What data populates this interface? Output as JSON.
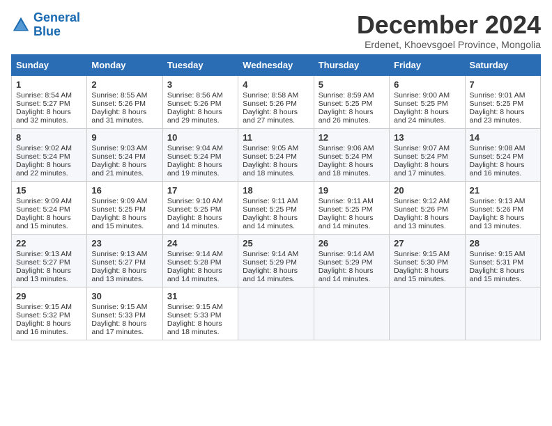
{
  "logo": {
    "line1": "General",
    "line2": "Blue"
  },
  "title": "December 2024",
  "location": "Erdenet, Khoevsgoel Province, Mongolia",
  "days_header": [
    "Sunday",
    "Monday",
    "Tuesday",
    "Wednesday",
    "Thursday",
    "Friday",
    "Saturday"
  ],
  "weeks": [
    [
      {
        "day": "1",
        "sunrise": "8:54 AM",
        "sunset": "5:27 PM",
        "daylight": "8 hours and 32 minutes."
      },
      {
        "day": "2",
        "sunrise": "8:55 AM",
        "sunset": "5:26 PM",
        "daylight": "8 hours and 31 minutes."
      },
      {
        "day": "3",
        "sunrise": "8:56 AM",
        "sunset": "5:26 PM",
        "daylight": "8 hours and 29 minutes."
      },
      {
        "day": "4",
        "sunrise": "8:58 AM",
        "sunset": "5:26 PM",
        "daylight": "8 hours and 27 minutes."
      },
      {
        "day": "5",
        "sunrise": "8:59 AM",
        "sunset": "5:25 PM",
        "daylight": "8 hours and 26 minutes."
      },
      {
        "day": "6",
        "sunrise": "9:00 AM",
        "sunset": "5:25 PM",
        "daylight": "8 hours and 24 minutes."
      },
      {
        "day": "7",
        "sunrise": "9:01 AM",
        "sunset": "5:25 PM",
        "daylight": "8 hours and 23 minutes."
      }
    ],
    [
      {
        "day": "8",
        "sunrise": "9:02 AM",
        "sunset": "5:24 PM",
        "daylight": "8 hours and 22 minutes."
      },
      {
        "day": "9",
        "sunrise": "9:03 AM",
        "sunset": "5:24 PM",
        "daylight": "8 hours and 21 minutes."
      },
      {
        "day": "10",
        "sunrise": "9:04 AM",
        "sunset": "5:24 PM",
        "daylight": "8 hours and 19 minutes."
      },
      {
        "day": "11",
        "sunrise": "9:05 AM",
        "sunset": "5:24 PM",
        "daylight": "8 hours and 18 minutes."
      },
      {
        "day": "12",
        "sunrise": "9:06 AM",
        "sunset": "5:24 PM",
        "daylight": "8 hours and 18 minutes."
      },
      {
        "day": "13",
        "sunrise": "9:07 AM",
        "sunset": "5:24 PM",
        "daylight": "8 hours and 17 minutes."
      },
      {
        "day": "14",
        "sunrise": "9:08 AM",
        "sunset": "5:24 PM",
        "daylight": "8 hours and 16 minutes."
      }
    ],
    [
      {
        "day": "15",
        "sunrise": "9:09 AM",
        "sunset": "5:24 PM",
        "daylight": "8 hours and 15 minutes."
      },
      {
        "day": "16",
        "sunrise": "9:09 AM",
        "sunset": "5:25 PM",
        "daylight": "8 hours and 15 minutes."
      },
      {
        "day": "17",
        "sunrise": "9:10 AM",
        "sunset": "5:25 PM",
        "daylight": "8 hours and 14 minutes."
      },
      {
        "day": "18",
        "sunrise": "9:11 AM",
        "sunset": "5:25 PM",
        "daylight": "8 hours and 14 minutes."
      },
      {
        "day": "19",
        "sunrise": "9:11 AM",
        "sunset": "5:25 PM",
        "daylight": "8 hours and 14 minutes."
      },
      {
        "day": "20",
        "sunrise": "9:12 AM",
        "sunset": "5:26 PM",
        "daylight": "8 hours and 13 minutes."
      },
      {
        "day": "21",
        "sunrise": "9:13 AM",
        "sunset": "5:26 PM",
        "daylight": "8 hours and 13 minutes."
      }
    ],
    [
      {
        "day": "22",
        "sunrise": "9:13 AM",
        "sunset": "5:27 PM",
        "daylight": "8 hours and 13 minutes."
      },
      {
        "day": "23",
        "sunrise": "9:13 AM",
        "sunset": "5:27 PM",
        "daylight": "8 hours and 13 minutes."
      },
      {
        "day": "24",
        "sunrise": "9:14 AM",
        "sunset": "5:28 PM",
        "daylight": "8 hours and 14 minutes."
      },
      {
        "day": "25",
        "sunrise": "9:14 AM",
        "sunset": "5:29 PM",
        "daylight": "8 hours and 14 minutes."
      },
      {
        "day": "26",
        "sunrise": "9:14 AM",
        "sunset": "5:29 PM",
        "daylight": "8 hours and 14 minutes."
      },
      {
        "day": "27",
        "sunrise": "9:15 AM",
        "sunset": "5:30 PM",
        "daylight": "8 hours and 15 minutes."
      },
      {
        "day": "28",
        "sunrise": "9:15 AM",
        "sunset": "5:31 PM",
        "daylight": "8 hours and 15 minutes."
      }
    ],
    [
      {
        "day": "29",
        "sunrise": "9:15 AM",
        "sunset": "5:32 PM",
        "daylight": "8 hours and 16 minutes."
      },
      {
        "day": "30",
        "sunrise": "9:15 AM",
        "sunset": "5:33 PM",
        "daylight": "8 hours and 17 minutes."
      },
      {
        "day": "31",
        "sunrise": "9:15 AM",
        "sunset": "5:33 PM",
        "daylight": "8 hours and 18 minutes."
      },
      null,
      null,
      null,
      null
    ]
  ],
  "labels": {
    "sunrise": "Sunrise:",
    "sunset": "Sunset:",
    "daylight": "Daylight:"
  }
}
